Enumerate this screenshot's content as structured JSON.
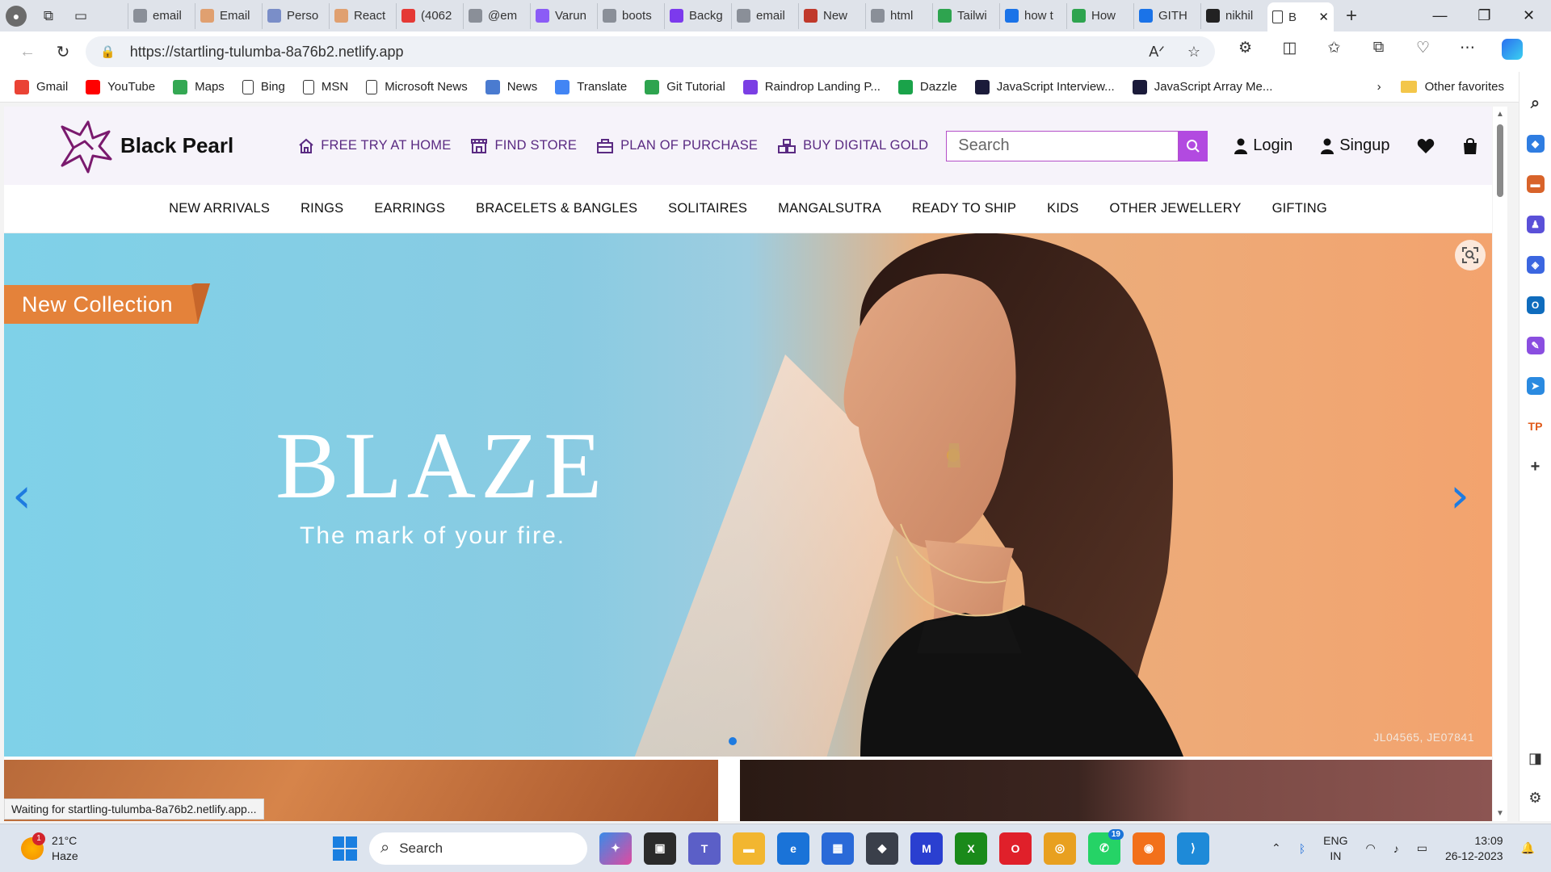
{
  "browser": {
    "tabs": [
      {
        "label": "email",
        "color": "#8a8f98"
      },
      {
        "label": "Email",
        "color": "#e0a070"
      },
      {
        "label": "Perso",
        "color": "#7a8ec8"
      },
      {
        "label": "React",
        "color": "#e0a070"
      },
      {
        "label": "(4062",
        "color": "#e53935"
      },
      {
        "label": "@em",
        "color": "#8a8f98"
      },
      {
        "label": "Varun",
        "color": "#8b5cf6"
      },
      {
        "label": "boots",
        "color": "#8a8f98"
      },
      {
        "label": "Backg",
        "color": "#7c3aed"
      },
      {
        "label": "email",
        "color": "#8a8f98"
      },
      {
        "label": "New",
        "color": "#c0392b"
      },
      {
        "label": "html",
        "color": "#8a8f98"
      },
      {
        "label": "Tailwi",
        "color": "#2ea44f"
      },
      {
        "label": "how t",
        "color": "#1a73e8"
      },
      {
        "label": "How",
        "color": "#2ea44f"
      },
      {
        "label": "GITH",
        "color": "#1a73e8"
      },
      {
        "label": "nikhil",
        "color": "#222222"
      }
    ],
    "active_tab": {
      "label": "B"
    },
    "url": "https://startling-tulumba-8a76b2.netlify.app",
    "status_text": "Waiting for startling-tulumba-8a76b2.netlify.app..."
  },
  "favorites": {
    "items": [
      {
        "label": "Gmail",
        "color": "#ea4335"
      },
      {
        "label": "YouTube",
        "color": "#ff0000"
      },
      {
        "label": "Maps",
        "color": "#34a853"
      },
      {
        "label": "Bing",
        "color": "#ffffff"
      },
      {
        "label": "MSN",
        "color": "#ffffff"
      },
      {
        "label": "Microsoft News",
        "color": "#ffffff"
      },
      {
        "label": "News",
        "color": "#4a7bd0"
      },
      {
        "label": "Translate",
        "color": "#4285f4"
      },
      {
        "label": "Git Tutorial",
        "color": "#2ea44f"
      },
      {
        "label": "Raindrop Landing P...",
        "color": "#7b3fe4"
      },
      {
        "label": "Dazzle",
        "color": "#1aa34a"
      },
      {
        "label": "JavaScript Interview...",
        "color": "#1b1b3a"
      },
      {
        "label": "JavaScript Array Me...",
        "color": "#1b1b3a"
      }
    ],
    "other": "Other favorites"
  },
  "site": {
    "brand": "Black Pearl",
    "header_nav": [
      {
        "label": "FREE TRY AT HOME",
        "icon": "home-icon"
      },
      {
        "label": "FIND STORE",
        "icon": "store-icon"
      },
      {
        "label": "PLAN OF PURCHASE",
        "icon": "briefcase-icon"
      },
      {
        "label": "BUY DIGITAL GOLD",
        "icon": "gold-bars-icon"
      }
    ],
    "search_placeholder": "Search",
    "login": "Login",
    "signup": "Singup",
    "categories": [
      "NEW ARRIVALS",
      "RINGS",
      "EARRINGS",
      "BRACELETS & BANGLES",
      "SOLITAIRES",
      "MANGALSUTRA",
      "READY TO SHIP",
      "KIDS",
      "OTHER JEWELLERY",
      "GIFTING"
    ],
    "accent": "#5a2a82",
    "search_color": "#b24ae0"
  },
  "hero": {
    "badge": "New Collection",
    "title": "BLAZE",
    "subtitle": "The mark of your fire.",
    "codes": "JL04565, JE07841",
    "arrow_color": "#1e7be0"
  },
  "taskbar": {
    "temp": "21°C",
    "weather": "Haze",
    "weather_badge": "1",
    "search": "Search",
    "whatsapp_badge": "19",
    "lang1": "ENG",
    "lang2": "IN",
    "time": "13:09",
    "date": "26-12-2023"
  }
}
